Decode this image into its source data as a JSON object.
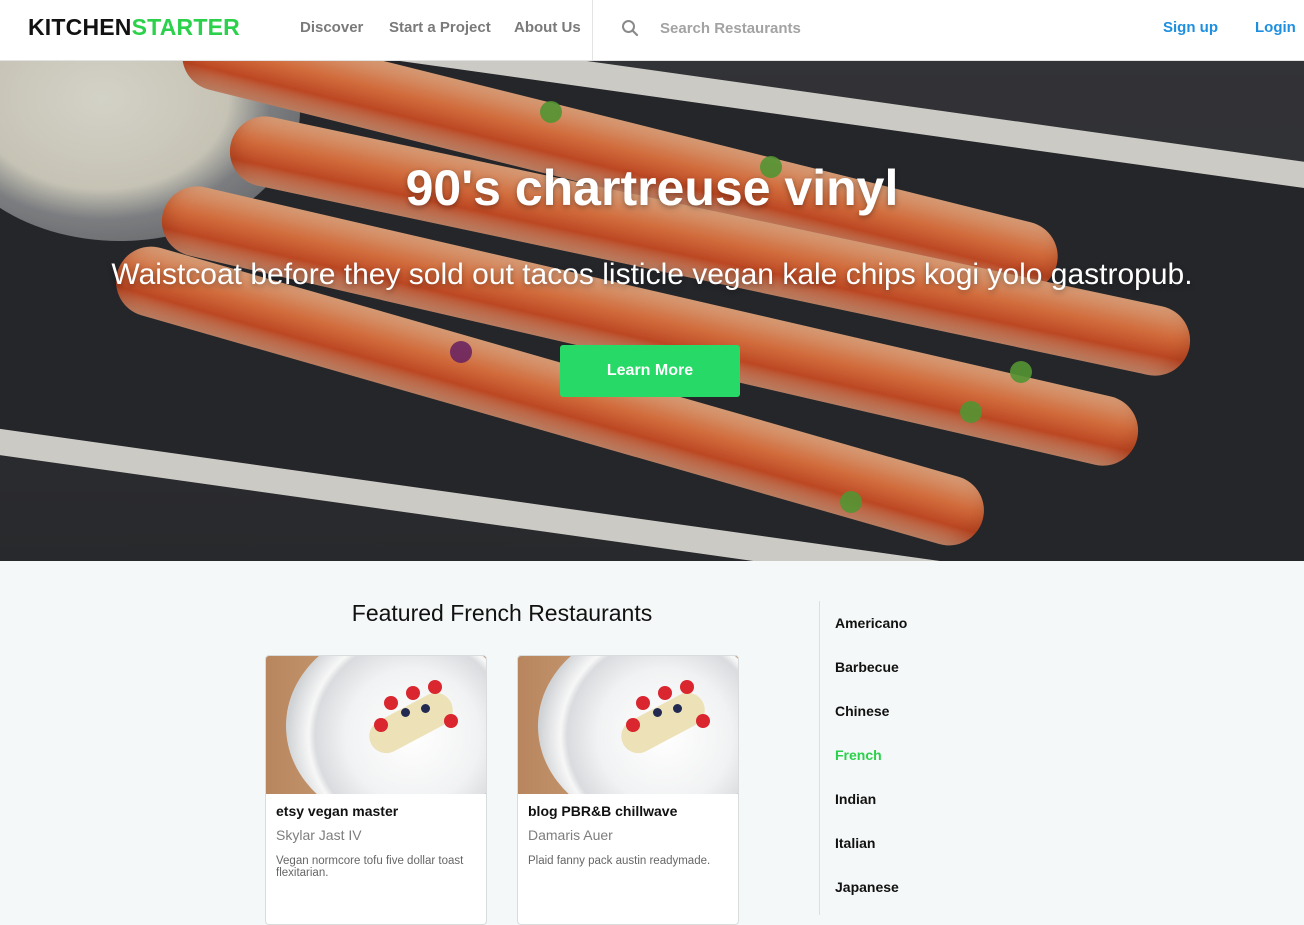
{
  "brand": {
    "part1": "KITCHEN",
    "part2": "STARTER"
  },
  "nav": {
    "discover": "Discover",
    "start_project": "Start a Project",
    "about": "About Us"
  },
  "search": {
    "placeholder": "Search Restaurants"
  },
  "auth": {
    "signup": "Sign up",
    "login": "Login"
  },
  "hero": {
    "title": "90's chartreuse vinyl",
    "subtitle": "Waistcoat before they sold out tacos listicle vegan kale chips kogi yolo gastropub.",
    "cta": "Learn More"
  },
  "featured": {
    "title": "Featured French Restaurants",
    "cards": [
      {
        "name": "etsy vegan master",
        "owner": "Skylar Jast IV",
        "description": "Vegan normcore tofu five dollar toast flexitarian."
      },
      {
        "name": "blog PBR&B chillwave",
        "owner": "Damaris Auer",
        "description": "Plaid fanny pack austin readymade."
      }
    ]
  },
  "categories": [
    "Americano",
    "Barbecue",
    "Chinese",
    "French",
    "Indian",
    "Italian",
    "Japanese"
  ],
  "active_category": "French",
  "colors": {
    "brand_green": "#2bd14b",
    "button_green": "#27d966",
    "link_blue": "#1e8fe0"
  }
}
